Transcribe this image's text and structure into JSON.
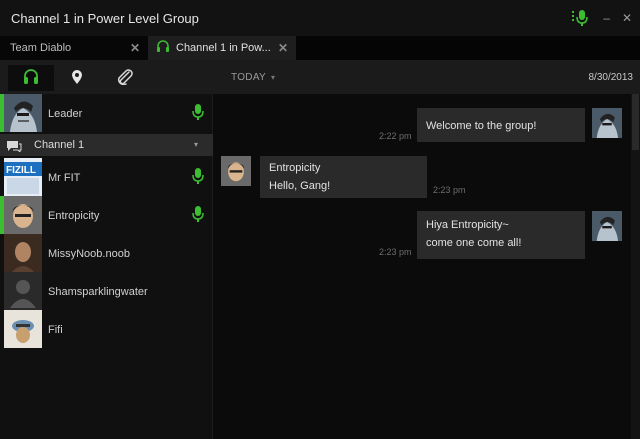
{
  "window": {
    "title": "Channel 1 in Power Level Group"
  },
  "tabs": [
    {
      "label": "Team Diablo",
      "close": "✕"
    },
    {
      "label": "Channel 1 in Pow...",
      "close": "✕"
    }
  ],
  "toolbar": {
    "filter_label": "TODAY",
    "filter_caret": "▾",
    "date": "8/30/2013"
  },
  "sidebar": {
    "leader": {
      "name": "Leader",
      "speaking": true
    },
    "channel": {
      "label": "Channel 1",
      "caret": "▾"
    },
    "members": [
      {
        "name": "Mr FIT",
        "speaking": true
      },
      {
        "name": "Entropicity",
        "speaking": true
      },
      {
        "name": "MissyNoob.noob",
        "speaking": false
      },
      {
        "name": "Shamsparklingwater",
        "speaking": false
      },
      {
        "name": "Fifi",
        "speaking": false
      }
    ]
  },
  "messages": [
    {
      "side": "right",
      "lines": [
        "Welcome to the group!"
      ],
      "time": "2:22 pm"
    },
    {
      "side": "left",
      "lines": [
        "Entropicity",
        "Hello, Gang!"
      ],
      "time": "2:23 pm"
    },
    {
      "side": "right",
      "lines": [
        "Hiya Entropicity~",
        "come one come all!"
      ],
      "time": "2:23 pm"
    }
  ],
  "colors": {
    "accent_green": "#3cbd32",
    "bubble": "#2a2a2a",
    "background": "#0b0b0b"
  },
  "icons": {
    "title_mic": "microphone-icon",
    "headset": "headset-icon",
    "location": "map-pin-icon",
    "attachment": "paperclip-icon",
    "channel": "chat-bubble-icon"
  }
}
